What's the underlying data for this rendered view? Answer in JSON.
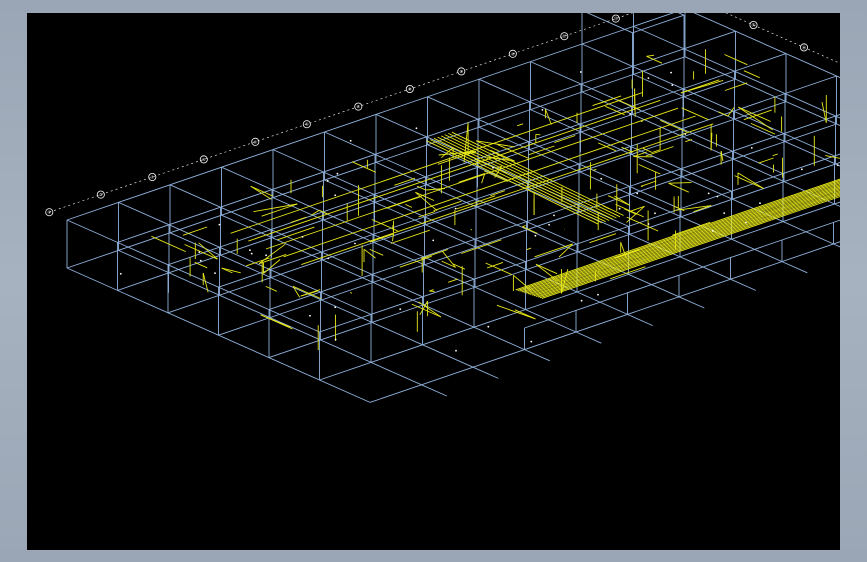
{
  "viewport": {
    "background": "#000000"
  },
  "colors": {
    "grid": "#8fb1dc",
    "pipe": "#e8e81a",
    "annotation": "#ffffff"
  },
  "axis_bubbles": {
    "top_row": [
      "①",
      "②",
      "③",
      "④",
      "⑤",
      "⑥",
      "⑦",
      "⑧",
      "⑨",
      "⑩",
      "⑪",
      "⑫",
      "⑬"
    ],
    "right_column": [
      "Ⓐ",
      "Ⓑ",
      "Ⓒ",
      "Ⓓ",
      "Ⓔ",
      "Ⓕ",
      "Ⓖ"
    ]
  }
}
